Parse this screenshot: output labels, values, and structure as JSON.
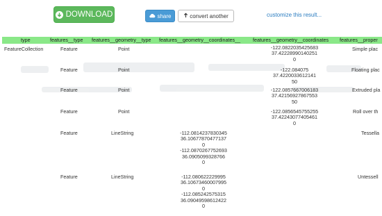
{
  "toolbar": {
    "download_label": "DOWNLOAD",
    "share_label": "share",
    "convert_label": "convert another",
    "customize_label": "customize this result..."
  },
  "table": {
    "headers": [
      "type",
      "features__type",
      "features__geometry__type",
      "features__geometry__coordinates__",
      "features__geometry__coordinates",
      "features__proper"
    ],
    "rows": [
      {
        "type": "FeatureCollection",
        "ftype": "Feature",
        "gtype": "Point",
        "coords_ls": [],
        "coords_pt": [
          "-122.0822035425683",
          "37.42228990140251",
          "0"
        ],
        "prop": "Simple plac"
      },
      {
        "type": "",
        "ftype": "Feature",
        "gtype": "Point",
        "coords_ls": [],
        "coords_pt": [
          "-122.084075",
          "37.4220033612141",
          "50"
        ],
        "prop": "Floating plac"
      },
      {
        "type": "",
        "ftype": "Feature",
        "gtype": "Point",
        "coords_ls": [],
        "coords_pt": [
          "-122.0857667006183",
          "37.42156927867553",
          "50"
        ],
        "prop": "Extruded pla"
      },
      {
        "type": "",
        "ftype": "Feature",
        "gtype": "Point",
        "coords_ls": [],
        "coords_pt": [
          "-122.0856545755255",
          "37.42243077405461",
          "0"
        ],
        "prop": "Roll over th"
      },
      {
        "type": "",
        "ftype": "Feature",
        "gtype": "LineString",
        "coords_ls": [
          "-112.0814237830345",
          "36.10677870477137",
          "0",
          "-112.0870267752693",
          "36.0905099328766",
          "0"
        ],
        "coords_pt": [],
        "prop": "Tessella"
      },
      {
        "type": "",
        "ftype": "Feature",
        "gtype": "LineString",
        "coords_ls": [
          "-112.080622229995",
          "36.10673460007995",
          "0",
          "-112.085242575315",
          "36.09049598612422",
          "0"
        ],
        "coords_pt": [],
        "prop": "Untessell"
      }
    ]
  }
}
